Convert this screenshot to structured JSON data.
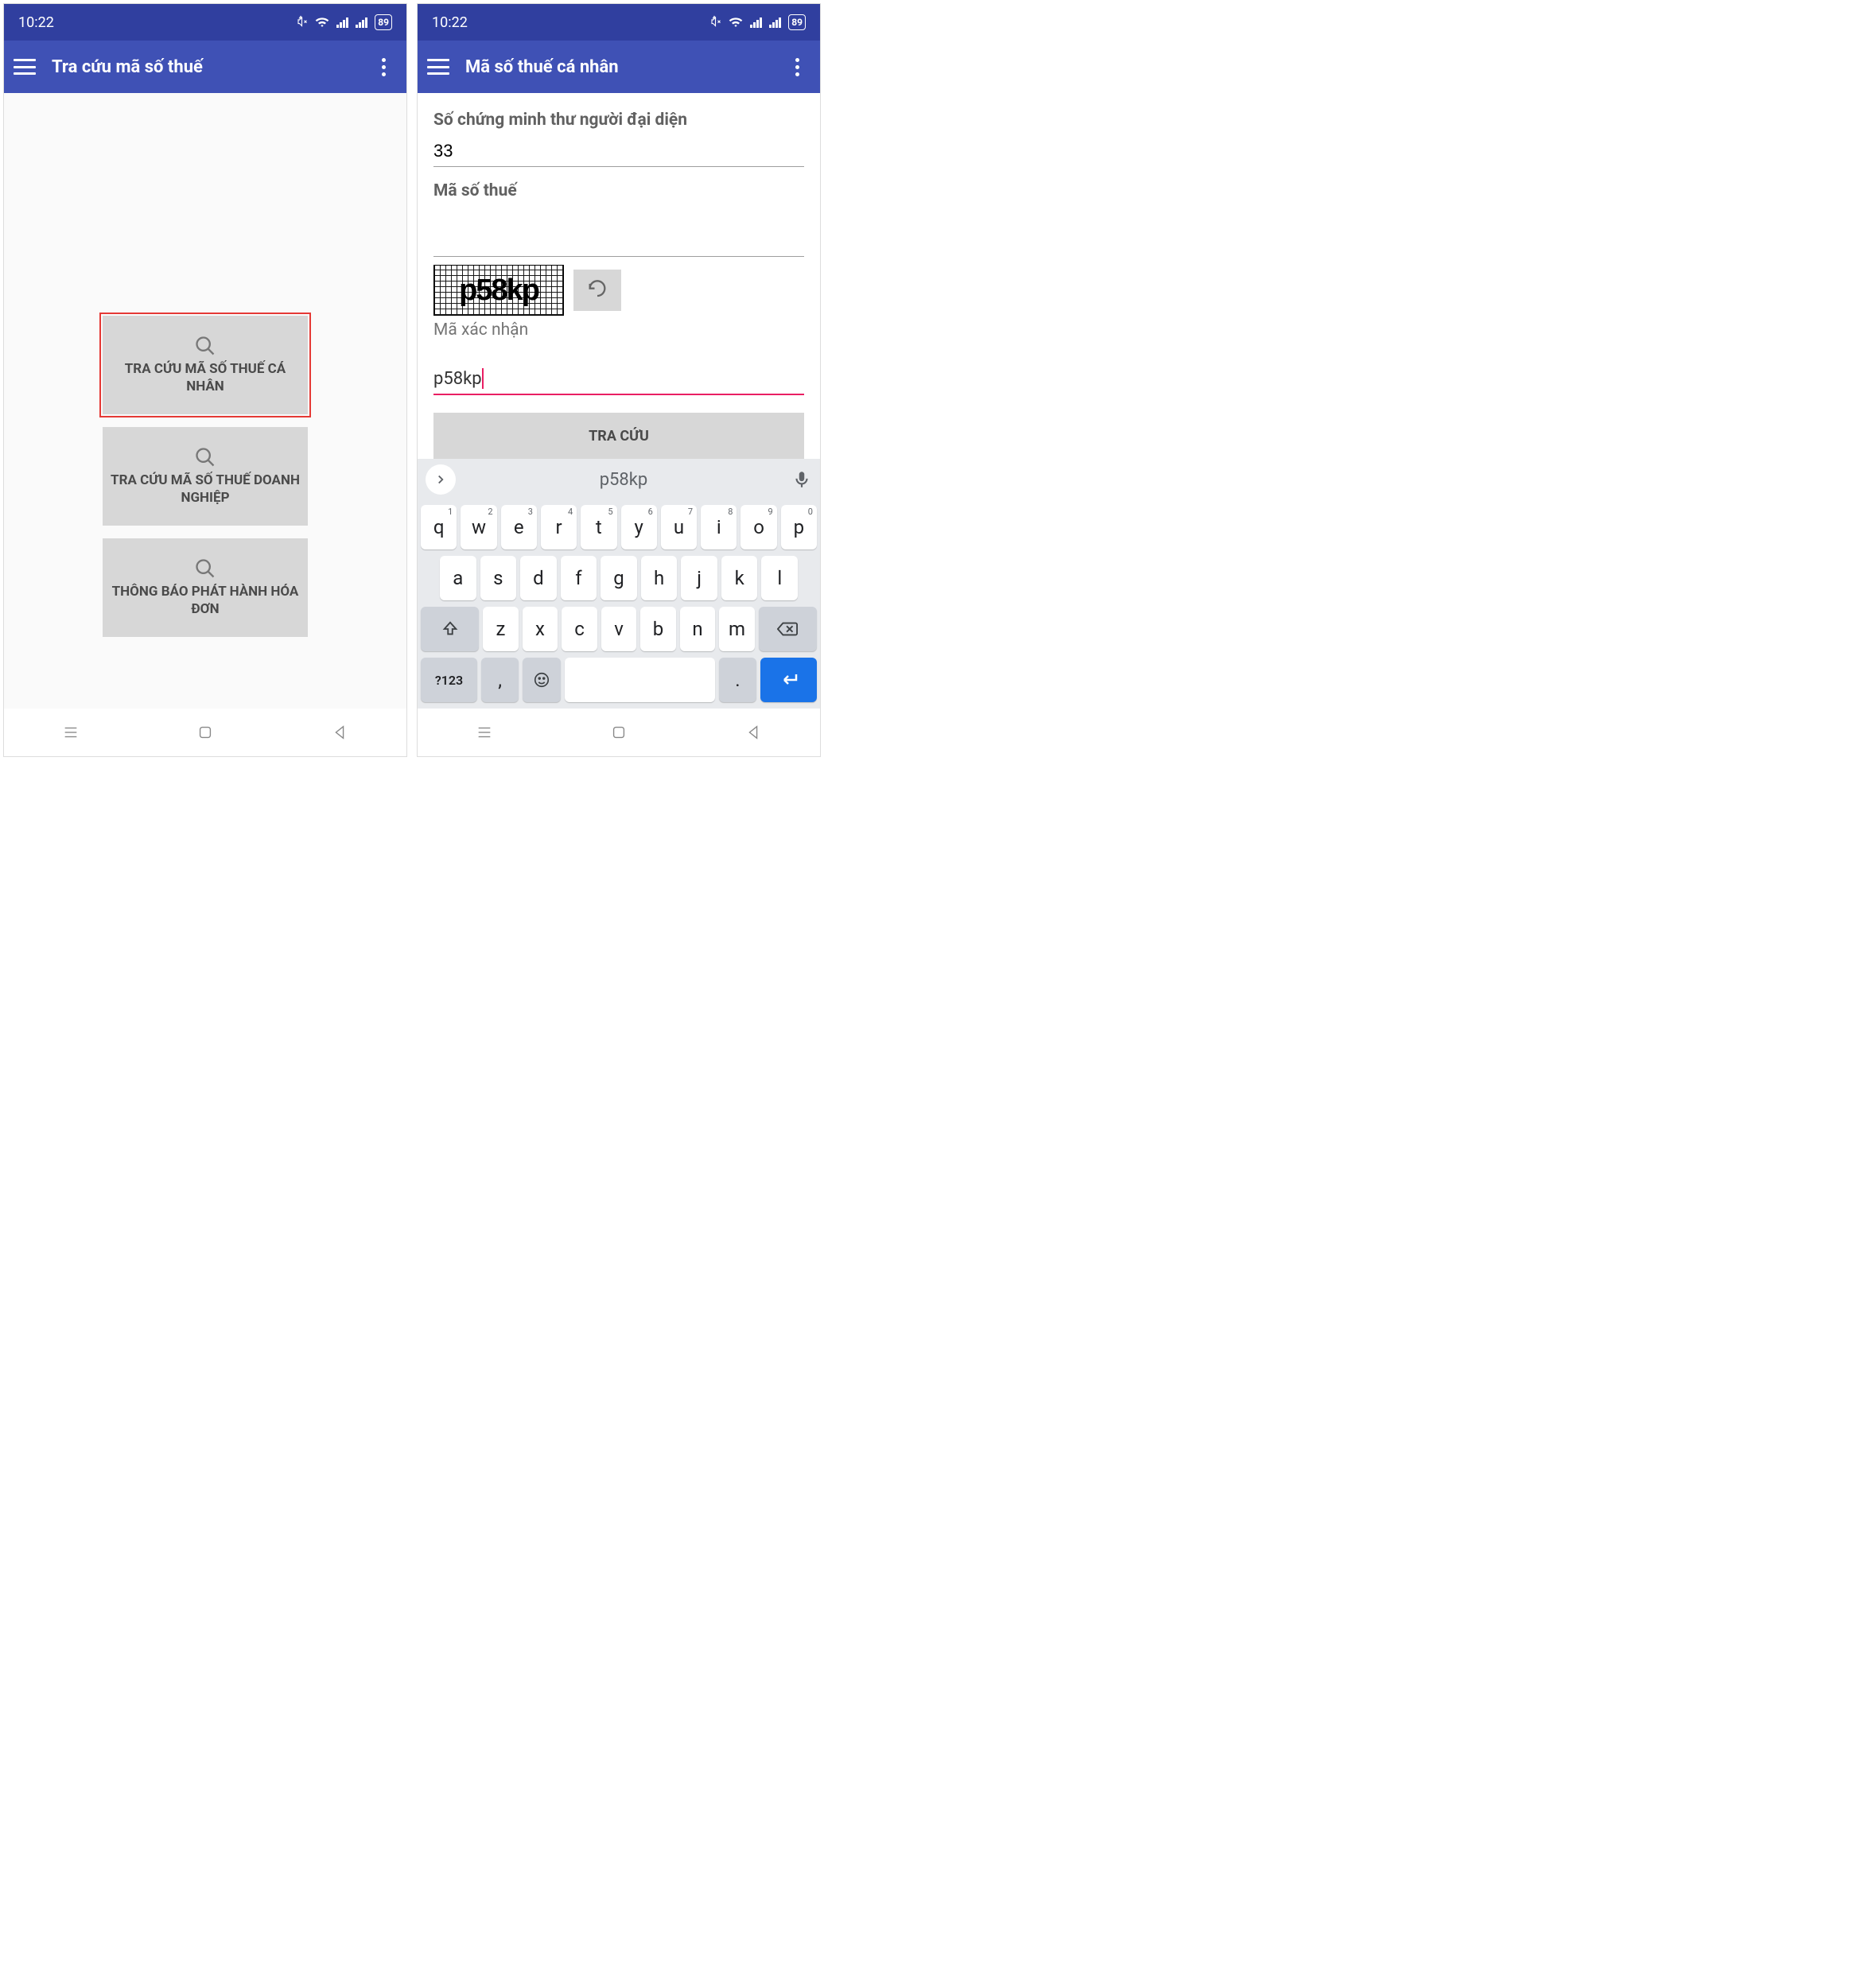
{
  "status": {
    "time": "10:22",
    "battery": "89"
  },
  "screen1": {
    "title": "Tra cứu mã số thuế",
    "buttons": [
      "TRA CỨU MÃ SỐ THUẾ CÁ NHÂN",
      "TRA CỨU MÃ SỐ THUẾ DOANH NGHIỆP",
      "THÔNG BÁO PHÁT HÀNH HÓA ĐƠN"
    ]
  },
  "screen2": {
    "title": "Mã số thuế cá nhân",
    "id_label": "Số chứng minh thư người đại diện",
    "id_value": "33",
    "tax_label": "Mã số thuế",
    "tax_value": "",
    "captcha_text": "p58kp",
    "captcha_label": "Mã xác nhận",
    "captcha_input": "p58kp",
    "submit": "TRA CỨU"
  },
  "keyboard": {
    "suggestion": "p58kp",
    "row1": [
      {
        "k": "q",
        "s": "1"
      },
      {
        "k": "w",
        "s": "2"
      },
      {
        "k": "e",
        "s": "3"
      },
      {
        "k": "r",
        "s": "4"
      },
      {
        "k": "t",
        "s": "5"
      },
      {
        "k": "y",
        "s": "6"
      },
      {
        "k": "u",
        "s": "7"
      },
      {
        "k": "i",
        "s": "8"
      },
      {
        "k": "o",
        "s": "9"
      },
      {
        "k": "p",
        "s": "0"
      }
    ],
    "row2": [
      "a",
      "s",
      "d",
      "f",
      "g",
      "h",
      "j",
      "k",
      "l"
    ],
    "row3": [
      "z",
      "x",
      "c",
      "v",
      "b",
      "n",
      "m"
    ],
    "symbols": "?123",
    "comma": ",",
    "period": "."
  }
}
